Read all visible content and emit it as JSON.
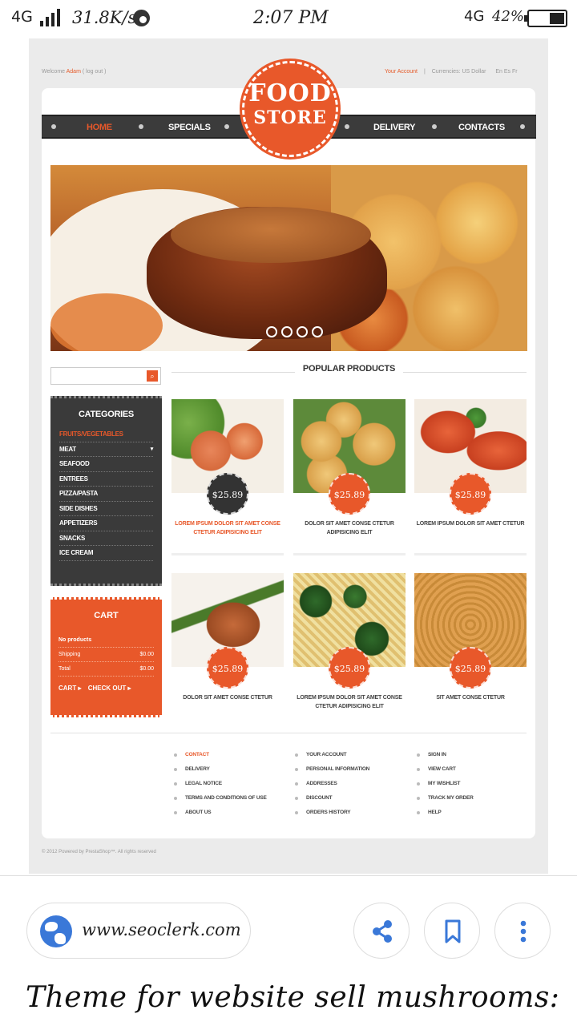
{
  "status_bar": {
    "network_left": "4G",
    "speed": "31.8K/s",
    "time": "2:07 PM",
    "network_right": "4G",
    "battery": "42%",
    "battery_level": 0.42
  },
  "site": {
    "welcome": "Welcome",
    "user": "Adam",
    "logout": "( log out )",
    "your_account": "Your Account",
    "currencies": "Currencies: US Dollar",
    "langs": "En  Es  Fr",
    "logo_line1": "FOOD",
    "logo_line2": "STORE",
    "nav": [
      "HOME",
      "SPECIALS",
      "DELIVERY",
      "CONTACTS"
    ],
    "popular_title": "POPULAR PRODUCTS",
    "categories_title": "CATEGORIES",
    "categories": [
      "FRUITS/VEGETABLES",
      "MEAT",
      "SEAFOOD",
      "ENTREES",
      "PIZZA/PASTA",
      "SIDE DISHES",
      "APPETIZERS",
      "SNACKS",
      "ICE CREAM"
    ],
    "cart_title": "CART",
    "cart_no_products": "No products",
    "cart_shipping_label": "Shipping",
    "cart_shipping_value": "$0.00",
    "cart_total_label": "Total",
    "cart_total_value": "$0.00",
    "cart_link": "CART",
    "checkout_link": "CHECK OUT",
    "products": [
      {
        "price": "$25.89",
        "name": "LOREM IPSUM DOLOR SIT AMET CONSE CTETUR ADIPISICING ELIT"
      },
      {
        "price": "$25.89",
        "name": "DOLOR SIT AMET CONSE CTETUR ADIPISICING ELIT"
      },
      {
        "price": "$25.89",
        "name": "LOREM IPSUM DOLOR SIT AMET CTETUR"
      },
      {
        "price": "$25.89",
        "name": "DOLOR SIT AMET CONSE CTETUR"
      },
      {
        "price": "$25.89",
        "name": "LOREM IPSUM DOLOR SIT AMET CONSE CTETUR ADIPISICING ELIT"
      },
      {
        "price": "$25.89",
        "name": "SIT AMET CONSE CTETUR"
      }
    ],
    "footer_col1": [
      "CONTACT",
      "DELIVERY",
      "LEGAL NOTICE",
      "TERMS AND CONDITIONS OF USE",
      "ABOUT US"
    ],
    "footer_col2": [
      "YOUR ACCOUNT",
      "PERSONAL INFORMATION",
      "ADDRESSES",
      "DISCOUNT",
      "ORDERS HISTORY"
    ],
    "footer_col3": [
      "SIGN IN",
      "VIEW CART",
      "MY WISHLIST",
      "TRACK MY ORDER",
      "HELP"
    ],
    "copyright": "© 2012 Powered by PrestaShop™. All rights reserved"
  },
  "browser": {
    "url": "www.seoclerk.com",
    "share_icon": "share-icon",
    "bookmark_icon": "bookmark-icon",
    "menu_icon": "more-vert-icon"
  },
  "caption": "Theme for website sell mushrooms:",
  "colors": {
    "accent": "#e8582a",
    "dark": "#3a3a3a",
    "link_blue": "#3a78d8"
  }
}
